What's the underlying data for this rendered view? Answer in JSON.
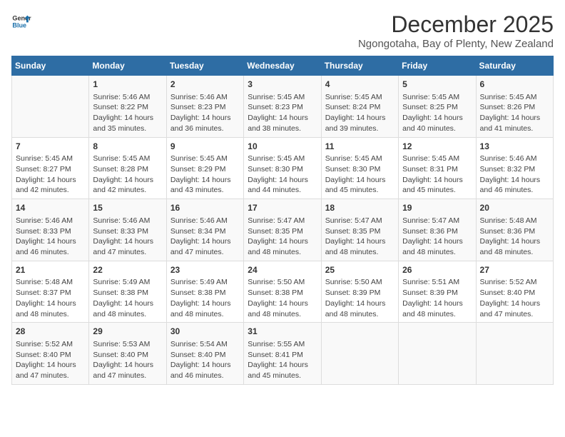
{
  "header": {
    "logo_line1": "General",
    "logo_line2": "Blue",
    "month_title": "December 2025",
    "location": "Ngongotaha, Bay of Plenty, New Zealand"
  },
  "days_of_week": [
    "Sunday",
    "Monday",
    "Tuesday",
    "Wednesday",
    "Thursday",
    "Friday",
    "Saturday"
  ],
  "weeks": [
    [
      {
        "day": "",
        "info": ""
      },
      {
        "day": "1",
        "info": "Sunrise: 5:46 AM\nSunset: 8:22 PM\nDaylight: 14 hours\nand 35 minutes."
      },
      {
        "day": "2",
        "info": "Sunrise: 5:46 AM\nSunset: 8:23 PM\nDaylight: 14 hours\nand 36 minutes."
      },
      {
        "day": "3",
        "info": "Sunrise: 5:45 AM\nSunset: 8:23 PM\nDaylight: 14 hours\nand 38 minutes."
      },
      {
        "day": "4",
        "info": "Sunrise: 5:45 AM\nSunset: 8:24 PM\nDaylight: 14 hours\nand 39 minutes."
      },
      {
        "day": "5",
        "info": "Sunrise: 5:45 AM\nSunset: 8:25 PM\nDaylight: 14 hours\nand 40 minutes."
      },
      {
        "day": "6",
        "info": "Sunrise: 5:45 AM\nSunset: 8:26 PM\nDaylight: 14 hours\nand 41 minutes."
      }
    ],
    [
      {
        "day": "7",
        "info": "Sunrise: 5:45 AM\nSunset: 8:27 PM\nDaylight: 14 hours\nand 42 minutes."
      },
      {
        "day": "8",
        "info": "Sunrise: 5:45 AM\nSunset: 8:28 PM\nDaylight: 14 hours\nand 42 minutes."
      },
      {
        "day": "9",
        "info": "Sunrise: 5:45 AM\nSunset: 8:29 PM\nDaylight: 14 hours\nand 43 minutes."
      },
      {
        "day": "10",
        "info": "Sunrise: 5:45 AM\nSunset: 8:30 PM\nDaylight: 14 hours\nand 44 minutes."
      },
      {
        "day": "11",
        "info": "Sunrise: 5:45 AM\nSunset: 8:30 PM\nDaylight: 14 hours\nand 45 minutes."
      },
      {
        "day": "12",
        "info": "Sunrise: 5:45 AM\nSunset: 8:31 PM\nDaylight: 14 hours\nand 45 minutes."
      },
      {
        "day": "13",
        "info": "Sunrise: 5:46 AM\nSunset: 8:32 PM\nDaylight: 14 hours\nand 46 minutes."
      }
    ],
    [
      {
        "day": "14",
        "info": "Sunrise: 5:46 AM\nSunset: 8:33 PM\nDaylight: 14 hours\nand 46 minutes."
      },
      {
        "day": "15",
        "info": "Sunrise: 5:46 AM\nSunset: 8:33 PM\nDaylight: 14 hours\nand 47 minutes."
      },
      {
        "day": "16",
        "info": "Sunrise: 5:46 AM\nSunset: 8:34 PM\nDaylight: 14 hours\nand 47 minutes."
      },
      {
        "day": "17",
        "info": "Sunrise: 5:47 AM\nSunset: 8:35 PM\nDaylight: 14 hours\nand 48 minutes."
      },
      {
        "day": "18",
        "info": "Sunrise: 5:47 AM\nSunset: 8:35 PM\nDaylight: 14 hours\nand 48 minutes."
      },
      {
        "day": "19",
        "info": "Sunrise: 5:47 AM\nSunset: 8:36 PM\nDaylight: 14 hours\nand 48 minutes."
      },
      {
        "day": "20",
        "info": "Sunrise: 5:48 AM\nSunset: 8:36 PM\nDaylight: 14 hours\nand 48 minutes."
      }
    ],
    [
      {
        "day": "21",
        "info": "Sunrise: 5:48 AM\nSunset: 8:37 PM\nDaylight: 14 hours\nand 48 minutes."
      },
      {
        "day": "22",
        "info": "Sunrise: 5:49 AM\nSunset: 8:38 PM\nDaylight: 14 hours\nand 48 minutes."
      },
      {
        "day": "23",
        "info": "Sunrise: 5:49 AM\nSunset: 8:38 PM\nDaylight: 14 hours\nand 48 minutes."
      },
      {
        "day": "24",
        "info": "Sunrise: 5:50 AM\nSunset: 8:38 PM\nDaylight: 14 hours\nand 48 minutes."
      },
      {
        "day": "25",
        "info": "Sunrise: 5:50 AM\nSunset: 8:39 PM\nDaylight: 14 hours\nand 48 minutes."
      },
      {
        "day": "26",
        "info": "Sunrise: 5:51 AM\nSunset: 8:39 PM\nDaylight: 14 hours\nand 48 minutes."
      },
      {
        "day": "27",
        "info": "Sunrise: 5:52 AM\nSunset: 8:40 PM\nDaylight: 14 hours\nand 47 minutes."
      }
    ],
    [
      {
        "day": "28",
        "info": "Sunrise: 5:52 AM\nSunset: 8:40 PM\nDaylight: 14 hours\nand 47 minutes."
      },
      {
        "day": "29",
        "info": "Sunrise: 5:53 AM\nSunset: 8:40 PM\nDaylight: 14 hours\nand 47 minutes."
      },
      {
        "day": "30",
        "info": "Sunrise: 5:54 AM\nSunset: 8:40 PM\nDaylight: 14 hours\nand 46 minutes."
      },
      {
        "day": "31",
        "info": "Sunrise: 5:55 AM\nSunset: 8:41 PM\nDaylight: 14 hours\nand 45 minutes."
      },
      {
        "day": "",
        "info": ""
      },
      {
        "day": "",
        "info": ""
      },
      {
        "day": "",
        "info": ""
      }
    ]
  ]
}
